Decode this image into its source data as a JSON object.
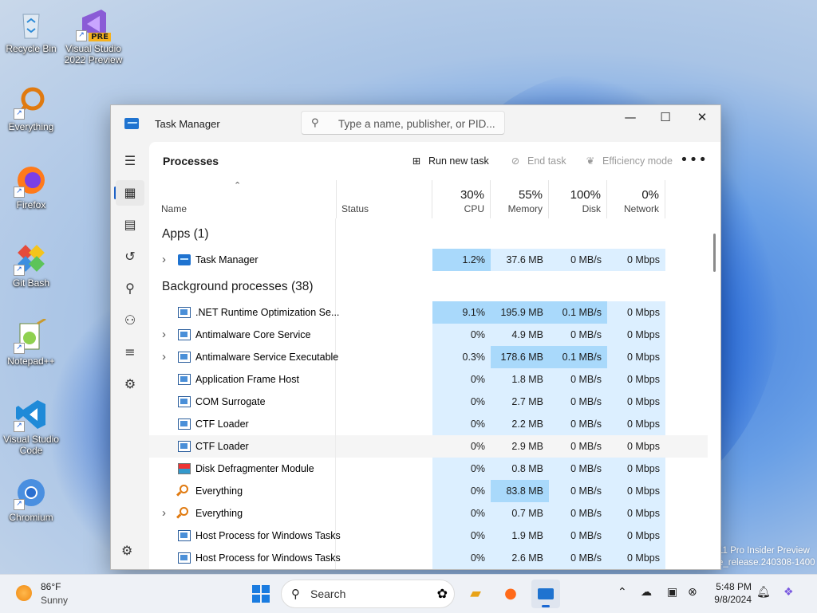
{
  "desktop": {
    "icons": [
      {
        "label": "Recycle Bin"
      },
      {
        "label": "Visual Studio 2022 Preview",
        "badge": "PRE"
      },
      {
        "label": "Everything"
      },
      {
        "label": "Firefox"
      },
      {
        "label": "Git Bash"
      },
      {
        "label": "Notepad++"
      },
      {
        "label": "Visual Studio Code"
      },
      {
        "label": "Chromium"
      }
    ],
    "watermark_line1": "11 Pro Insider Preview",
    "watermark_line2": "e_release.240308-1400"
  },
  "window": {
    "title": "Task Manager",
    "search_placeholder": "Type a name, publisher, or PID...",
    "controls": {
      "minimize": "—",
      "maximize": "☐",
      "close": "✕"
    }
  },
  "nav": {
    "items": [
      {
        "icon": "hamburger-icon",
        "glyph": "☰"
      },
      {
        "icon": "processes-icon",
        "glyph": "▦"
      },
      {
        "icon": "performance-icon",
        "glyph": "▤"
      },
      {
        "icon": "app-history-icon",
        "glyph": "↺"
      },
      {
        "icon": "startup-apps-icon",
        "glyph": "⚲"
      },
      {
        "icon": "users-icon",
        "glyph": "⚇"
      },
      {
        "icon": "details-icon",
        "glyph": "≡"
      },
      {
        "icon": "services-icon",
        "glyph": "⚙"
      }
    ],
    "settings_glyph": "⚙"
  },
  "cmdbar": {
    "page_title": "Processes",
    "run_new_task": "Run new task",
    "end_task": "End task",
    "efficiency_mode": "Efficiency mode",
    "more": "•••"
  },
  "columns": {
    "name": "Name",
    "status": "Status",
    "cpu": {
      "pct": "30%",
      "label": "CPU"
    },
    "memory": {
      "pct": "55%",
      "label": "Memory"
    },
    "disk": {
      "pct": "100%",
      "label": "Disk"
    },
    "network": {
      "pct": "0%",
      "label": "Network"
    }
  },
  "groups": {
    "apps": "Apps (1)",
    "background": "Background processes (38)"
  },
  "apps": [
    {
      "name": "Task Manager",
      "icon": "task-manager",
      "expand": true,
      "cpu": "1.2%",
      "memory": "37.6 MB",
      "disk": "0 MB/s",
      "network": "0 Mbps",
      "heat": [
        2,
        1,
        1,
        1
      ]
    }
  ],
  "processes": [
    {
      "name": ".NET Runtime Optimization Se...",
      "icon": "win",
      "expand": false,
      "cpu": "9.1%",
      "memory": "195.9 MB",
      "disk": "0.1 MB/s",
      "network": "0 Mbps",
      "heat": [
        2,
        2,
        2,
        1
      ]
    },
    {
      "name": "Antimalware Core Service",
      "icon": "win",
      "expand": true,
      "cpu": "0%",
      "memory": "4.9 MB",
      "disk": "0 MB/s",
      "network": "0 Mbps",
      "heat": [
        1,
        1,
        1,
        1
      ]
    },
    {
      "name": "Antimalware Service Executable",
      "icon": "win",
      "expand": true,
      "cpu": "0.3%",
      "memory": "178.6 MB",
      "disk": "0.1 MB/s",
      "network": "0 Mbps",
      "heat": [
        1,
        2,
        2,
        1
      ]
    },
    {
      "name": "Application Frame Host",
      "icon": "win",
      "expand": false,
      "cpu": "0%",
      "memory": "1.8 MB",
      "disk": "0 MB/s",
      "network": "0 Mbps",
      "heat": [
        1,
        1,
        1,
        1
      ]
    },
    {
      "name": "COM Surrogate",
      "icon": "win",
      "expand": false,
      "cpu": "0%",
      "memory": "2.7 MB",
      "disk": "0 MB/s",
      "network": "0 Mbps",
      "heat": [
        1,
        1,
        1,
        1
      ]
    },
    {
      "name": "CTF Loader",
      "icon": "win",
      "expand": false,
      "cpu": "0%",
      "memory": "2.2 MB",
      "disk": "0 MB/s",
      "network": "0 Mbps",
      "heat": [
        1,
        1,
        1,
        1
      ]
    },
    {
      "name": "CTF Loader",
      "icon": "win",
      "expand": false,
      "cpu": "0%",
      "memory": "2.9 MB",
      "disk": "0 MB/s",
      "network": "0 Mbps",
      "heat": [
        0,
        0,
        0,
        0
      ],
      "hover": true
    },
    {
      "name": "Disk Defragmenter Module",
      "icon": "df",
      "expand": false,
      "cpu": "0%",
      "memory": "0.8 MB",
      "disk": "0 MB/s",
      "network": "0 Mbps",
      "heat": [
        1,
        1,
        1,
        1
      ]
    },
    {
      "name": "Everything",
      "icon": "ev",
      "expand": false,
      "cpu": "0%",
      "memory": "83.8 MB",
      "disk": "0 MB/s",
      "network": "0 Mbps",
      "heat": [
        1,
        2,
        1,
        1
      ]
    },
    {
      "name": "Everything",
      "icon": "ev",
      "expand": true,
      "cpu": "0%",
      "memory": "0.7 MB",
      "disk": "0 MB/s",
      "network": "0 Mbps",
      "heat": [
        1,
        1,
        1,
        1
      ]
    },
    {
      "name": "Host Process for Windows Tasks",
      "icon": "win",
      "expand": false,
      "cpu": "0%",
      "memory": "1.9 MB",
      "disk": "0 MB/s",
      "network": "0 Mbps",
      "heat": [
        1,
        1,
        1,
        1
      ]
    },
    {
      "name": "Host Process for Windows Tasks",
      "icon": "win",
      "expand": false,
      "cpu": "0%",
      "memory": "2.6 MB",
      "disk": "0 MB/s",
      "network": "0 Mbps",
      "heat": [
        1,
        1,
        1,
        1
      ]
    }
  ],
  "colors": {
    "heat0": "#f5f5f5",
    "heat1": "#dcefff",
    "heat2": "#a9d9fb",
    "accent": "#1f62c6"
  },
  "taskbar": {
    "weather_temp": "86°F",
    "weather_desc": "Sunny",
    "search_label": "Search",
    "time": "5:48 PM",
    "date": "9/8/2024"
  }
}
